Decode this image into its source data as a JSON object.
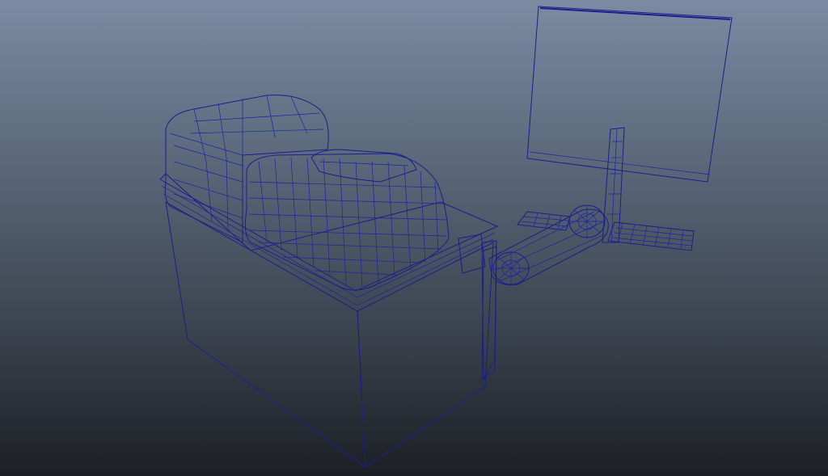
{
  "viewport": {
    "background_top": "#7a8ba3",
    "background_bottom": "#1c1f24",
    "wire_color": "#1a1f8a",
    "shading_color": "#8a8a8a"
  },
  "scene": {
    "objects": [
      "cabinet",
      "cushioned-seat",
      "articulated-arm",
      "keyboard",
      "monitor"
    ]
  }
}
